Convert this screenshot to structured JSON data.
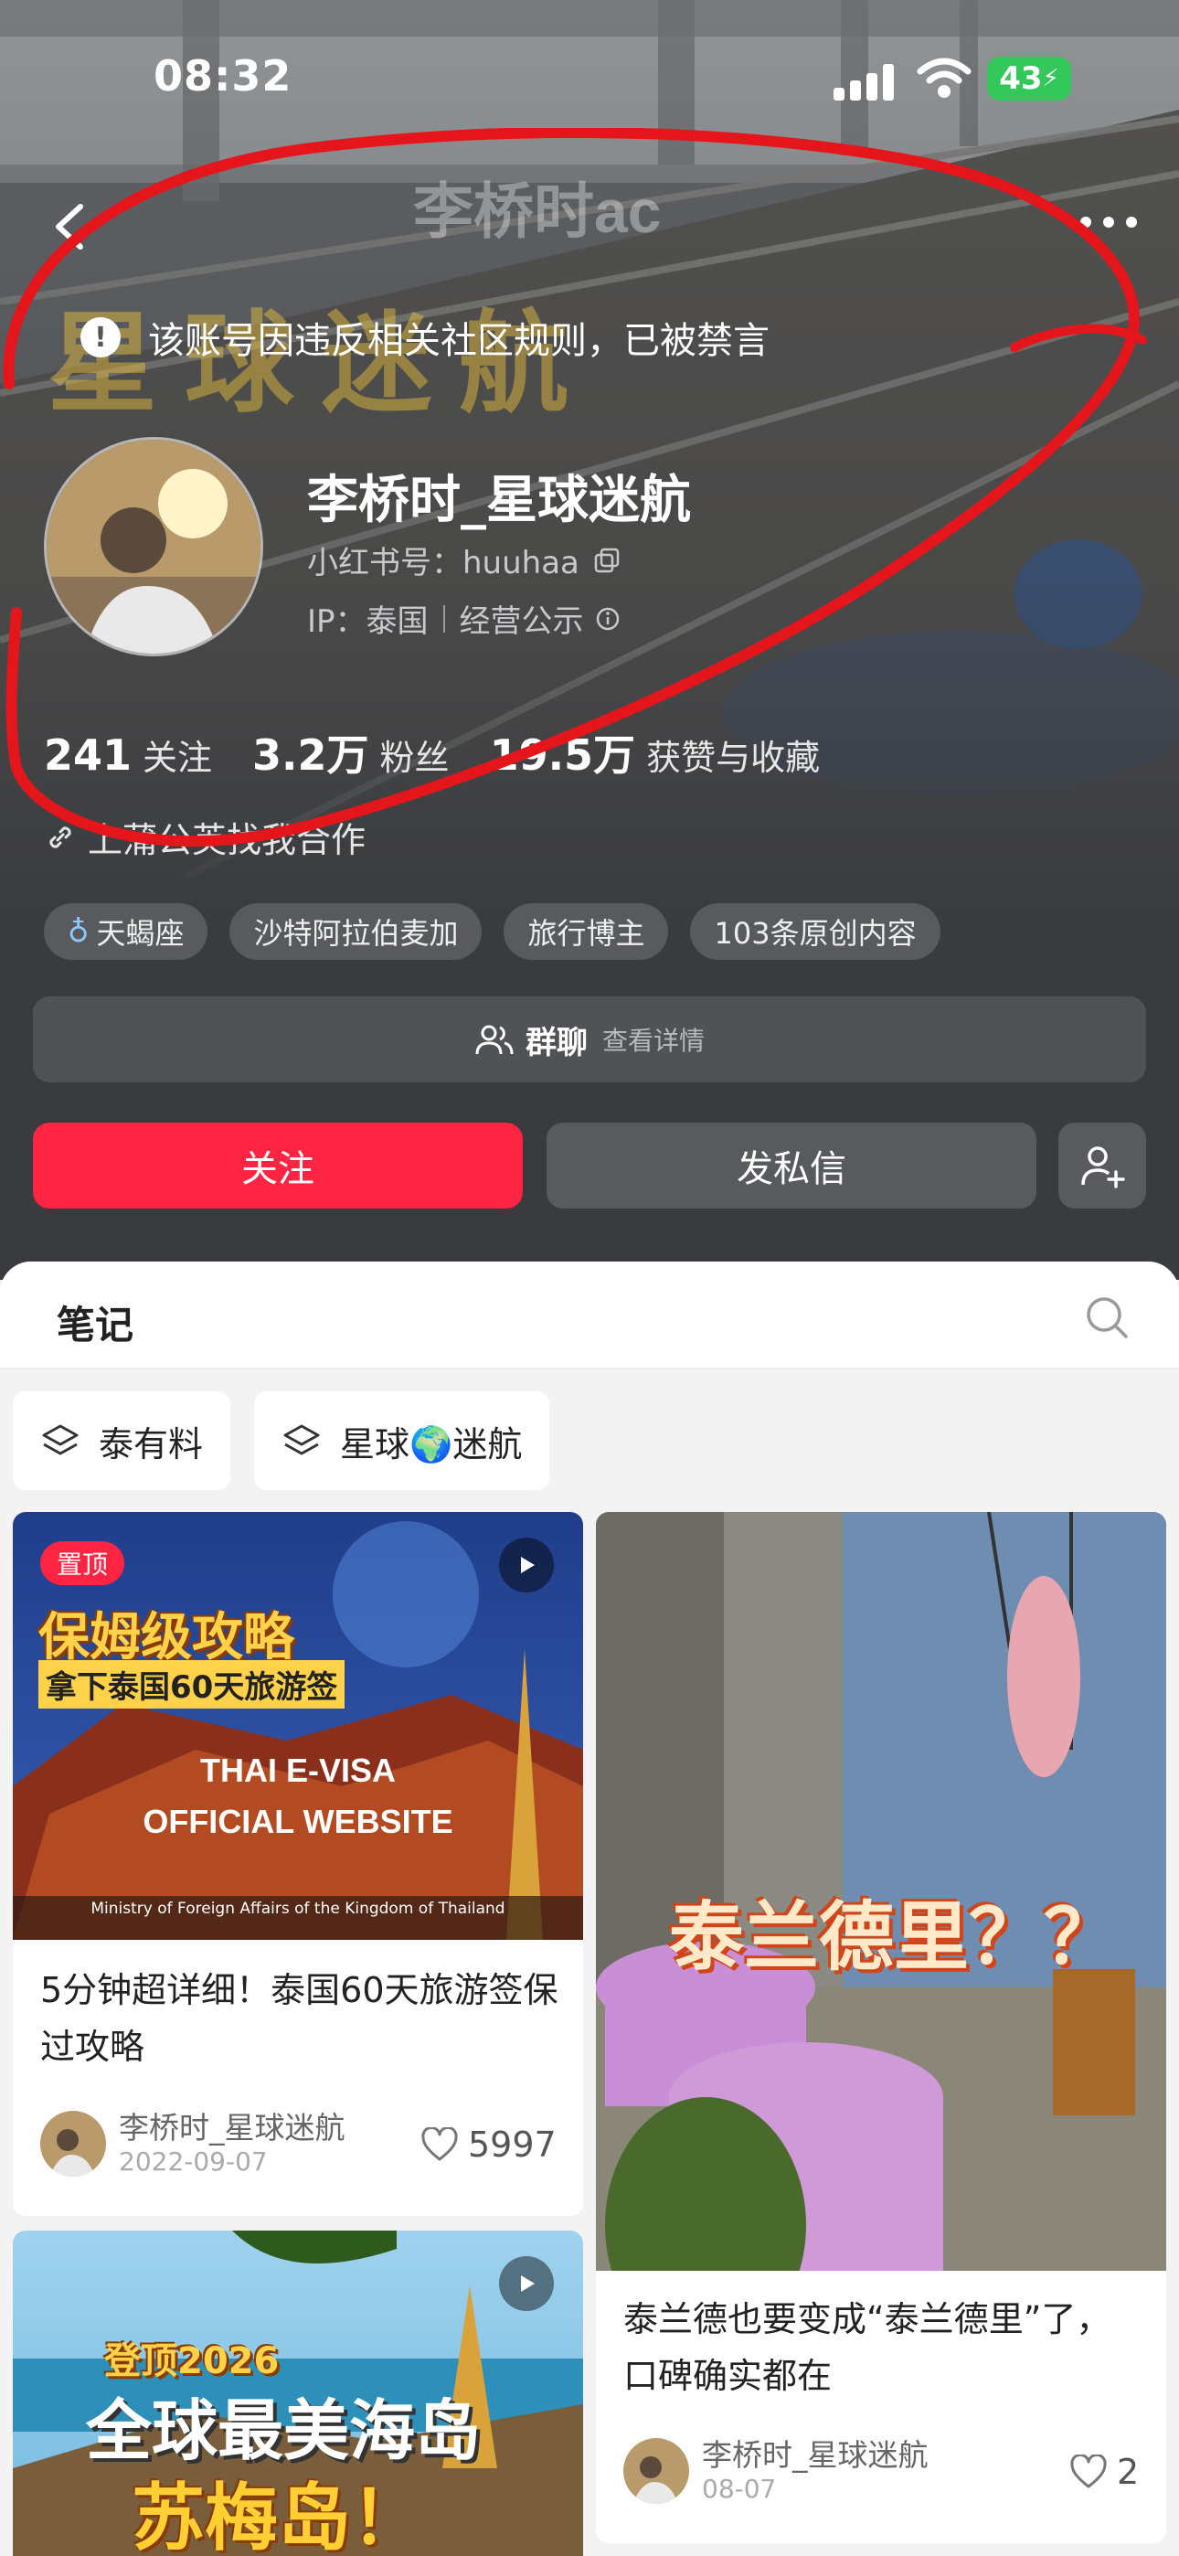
{
  "status_bar": {
    "time": "08:32",
    "battery": "43"
  },
  "profile": {
    "ban_notice": "该账号因违反相关社区规则，已被禁言",
    "name": "李桥时_星球迷航",
    "id_text": "小红书号：huuhaa",
    "ip_text": "IP：泰国",
    "disclosure": "经营公示",
    "stats": [
      {
        "value": "241",
        "label": "关注"
      },
      {
        "value": "3.2万",
        "label": "粉丝"
      },
      {
        "value": "19.5万",
        "label": "获赞与收藏"
      }
    ],
    "coop_link": "上蒲公英找我合作",
    "tags": [
      "天蝎座",
      "沙特阿拉伯麦加",
      "旅行博主",
      "103条原创内容"
    ],
    "group_chat": {
      "label": "群聊",
      "detail": "查看详情"
    },
    "follow_label": "关注",
    "dm_label": "发私信",
    "cover_text": {
      "top": "李桥时ac",
      "main": "星球迷航"
    }
  },
  "content": {
    "tab_label": "笔记",
    "collections": [
      "泰有料",
      "星球🌍迷航"
    ],
    "notes": [
      {
        "pinned_label": "置顶",
        "cover_lines": [
          "保姆级攻略",
          "拿下泰国60天旅游签",
          "THAI E-VISA",
          "OFFICIAL WEBSITE",
          "Ministry of Foreign Affairs of the Kingdom of Thailand"
        ],
        "title": "5分钟超详细！泰国60天旅游签保过攻略",
        "author": "李桥时_星球迷航",
        "date": "2022-09-07",
        "likes": "5997"
      },
      {
        "cover_lines": [
          "泰兰德里？？"
        ],
        "title": "泰兰德也要变成“泰兰德里”了，口碑确实都在",
        "author": "李桥时_星球迷航",
        "date": "08-07",
        "likes": "2"
      },
      {
        "cover_lines": [
          "登顶2026",
          "全球最美海岛",
          "苏梅岛！"
        ]
      }
    ]
  },
  "colors": {
    "accent": "#ff2442",
    "battery": "#34c759",
    "annotation": "#e4161b"
  }
}
